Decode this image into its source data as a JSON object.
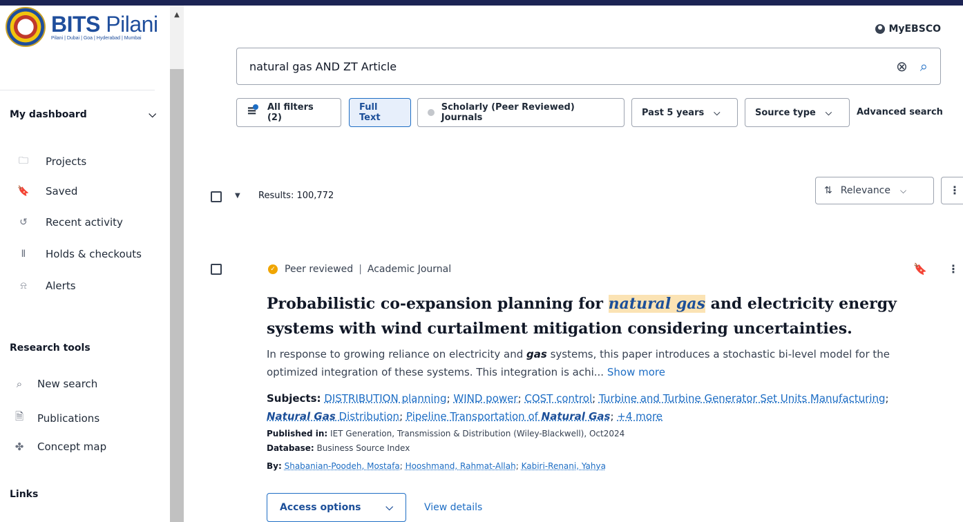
{
  "brand": {
    "title_bold": "BITS",
    "title_rest": " Pilani",
    "campuses": "Pilani | Dubai | Goa | Hyderabad | Mumbai"
  },
  "header": {
    "myebsco": "MyEBSCO"
  },
  "sidebar": {
    "dashboard_label": "My dashboard",
    "dashboard_items": [
      {
        "label": "Projects",
        "icon": "folder-icon"
      },
      {
        "label": "Saved",
        "icon": "bookmark-icon"
      },
      {
        "label": "Recent activity",
        "icon": "history-icon"
      },
      {
        "label": "Holds & checkouts",
        "icon": "library-icon"
      },
      {
        "label": "Alerts",
        "icon": "bell-icon"
      }
    ],
    "research_tools_label": "Research tools",
    "research_tools": [
      {
        "label": "New search",
        "icon": "search-icon"
      },
      {
        "label": "Publications",
        "icon": "document-icon"
      },
      {
        "label": "Concept map",
        "icon": "concept-map-icon"
      }
    ],
    "links_label": "Links"
  },
  "search": {
    "query": "natural gas AND ZT Article"
  },
  "filters": {
    "all_filters": "All filters (2)",
    "full_text": "Full Text",
    "scholarly": "Scholarly (Peer Reviewed) Journals",
    "date": "Past 5 years",
    "source_type": "Source type",
    "advanced": "Advanced search"
  },
  "results": {
    "count_label": "Results: 100,772",
    "sort": "Relevance"
  },
  "result": {
    "peer_reviewed": "Peer reviewed",
    "pub_type": "Academic Journal",
    "title_pre": "Probabilistic co-expansion planning for ",
    "title_hl": "natural gas",
    "title_post": " and electricity energy systems with wind curtailment mitigation considering uncertainties.",
    "abstract_pre": "In response to growing reliance on electricity and ",
    "abstract_kw": "gas",
    "abstract_post": " systems, this paper introduces a stochastic bi-level model for the optimized integration of these systems. This integration is achi...",
    "show_more": "Show more",
    "subjects_label": "Subjects:",
    "subjects": [
      "DISTRIBUTION planning",
      "WIND power",
      "COST control",
      "Turbine and Turbine Generator Set Units Manufacturing"
    ],
    "subject_ng_dist_kw": "Natural Gas",
    "subject_ng_dist_rest": " Distribution",
    "subject_pipeline_pre": "Pipeline Transportation of ",
    "subject_pipeline_kw": "Natural Gas",
    "subjects_more": "+4 more",
    "published_label": "Published in:",
    "published": "IET Generation, Transmission & Distribution (Wiley-Blackwell), Oct2024",
    "database_label": "Database:",
    "database": "Business Source Index",
    "by_label": "By:",
    "authors": [
      "Shabanian-Poodeh, Mostafa",
      "Hooshmand, Rahmat-Allah",
      "Kabiri-Renani, Yahya"
    ],
    "access_options": "Access options",
    "view_details": "View details"
  },
  "colors": {
    "accent": "#1d6dc4",
    "highlight": "#fbe3b4",
    "topbar": "#1c2454",
    "peer_badge": "#f0a500"
  }
}
